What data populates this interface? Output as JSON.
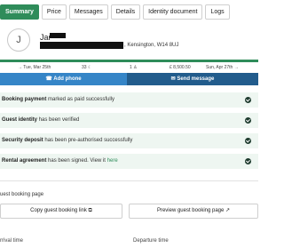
{
  "tabs": [
    {
      "label": "Summary"
    },
    {
      "label": "Price"
    },
    {
      "label": "Messages"
    },
    {
      "label": "Details"
    },
    {
      "label": "Identity document"
    },
    {
      "label": "Logs"
    }
  ],
  "guest": {
    "avatar_initial": "J",
    "name_visible": "Jar",
    "address_visible": ", Kensington, W14 8UJ"
  },
  "booking_meta": {
    "checkin": "→ Tue, Mar 25th",
    "nights": "33",
    "guests": "1",
    "price": "£ 8,500.50",
    "checkout": "Sun, Apr 27th →"
  },
  "actions": {
    "add_phone": "Add phone",
    "send_message": "Send message"
  },
  "statuses": [
    {
      "bold": "Booking payment",
      "text": " marked as paid successfully",
      "link": ""
    },
    {
      "bold": "Guest identity",
      "text": " has been verified",
      "link": ""
    },
    {
      "bold": "Security deposit",
      "text": " has been pre-authorised successfully",
      "link": ""
    },
    {
      "bold": "Rental agreement",
      "text": " has been signed. View it ",
      "link": "here"
    }
  ],
  "guest_booking": {
    "heading": "uest booking page",
    "copy_label": "Copy guest booking link",
    "preview_label": "Preview guest booking page"
  },
  "times": {
    "arrival": "rrival time",
    "departure": "Departure time"
  },
  "colors": {
    "brand_green": "#2f8c5a",
    "add_phone_blue": "#3585c7",
    "send_message_blue": "#225c8c",
    "status_bg": "#eef6f1"
  }
}
